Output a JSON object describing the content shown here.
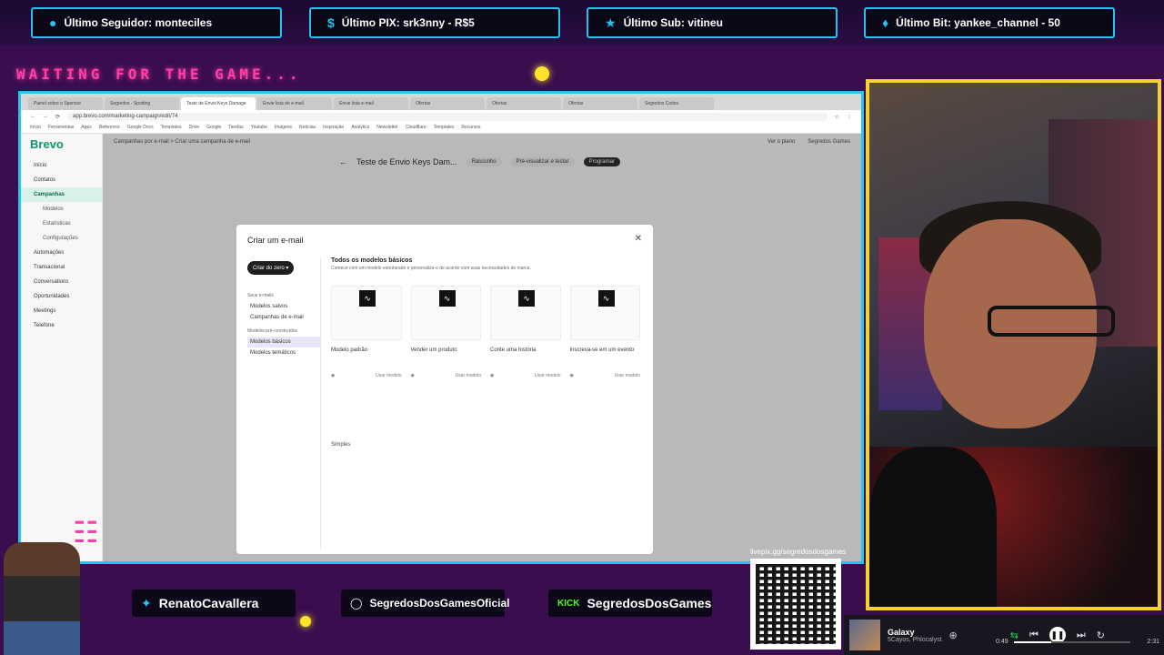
{
  "alerts": [
    {
      "icon": "person-icon",
      "label": "Último Seguidor: monteciles"
    },
    {
      "icon": "dollar-icon",
      "label": "Último PIX: srk3nny - R$5"
    },
    {
      "icon": "star-icon",
      "label": "Último Sub: vitineu"
    },
    {
      "icon": "gem-icon",
      "label": "Último Bit: yankee_channel - 50"
    }
  ],
  "waiting_text": "WAITING FOR THE GAME...",
  "browser": {
    "tabs": [
      "Painel sobre o Sponsor",
      "Segredos - Spotting",
      "Teste de Envio Keys Damage",
      "Envie lista de e-mail",
      "Envie lista e-mail",
      "Ofertas",
      "Ofertas",
      "Ofertas",
      "Segredos Codes"
    ],
    "url": "app.brevo.com/marketing-campaign/edit/74",
    "bookmarks": [
      "Início",
      "Ferramentas",
      "Apps",
      "Reference",
      "Google Docs",
      "Templates",
      "Drive",
      "Google",
      "Tarefas",
      "Youtube",
      "Imagens",
      "Notícias",
      "Inspiração",
      "Analytics",
      "Newsletter",
      "Cloudflare",
      "Templates",
      "Recursos"
    ]
  },
  "app": {
    "brand": "Brevo",
    "breadcrumb": "Campanhas por e-mail  >  Criar uma campanha de e-mail",
    "header_right": [
      "Ver o plano",
      "Segredos Games"
    ],
    "nav": [
      "Início",
      "Contatos",
      "Campanhas",
      "Modelos",
      "Estatísticas",
      "Configurações",
      "Automações",
      "Transacional",
      "Conversations",
      "Oportunidades",
      "Meetings",
      "Telefone"
    ],
    "campaign_name": "Teste de Envio Keys Dam...",
    "status": "Rascunho",
    "preview_label": "Pré-visualizar e testar",
    "schedule_label": "Programar"
  },
  "modal": {
    "title": "Criar um e-mail",
    "create_label": "Criar do zero",
    "your_emails_label": "Seus e-mails",
    "saved_templates": "Modelos salvos",
    "campaigns_email": "Campanhas de e-mail",
    "prebuilt_label": "Modelos pré-construídos",
    "basic_templates": "Modelos básicos",
    "themed_templates": "Modelos temáticos",
    "section_title": "Todos os modelos básicos",
    "section_desc": "Comece com um modelo estruturado e personalize-o de acordo com suas necessidades de marca.",
    "cards": [
      {
        "name": "Modelo padrão",
        "use": "Usar modelo"
      },
      {
        "name": "Vender um produto",
        "use": "Usar modelo"
      },
      {
        "name": "Conte uma história",
        "use": "Usar modelo"
      },
      {
        "name": "Inscreva-se em um evento",
        "use": "Usar modelo"
      }
    ],
    "simple_title": "Simples"
  },
  "socials": [
    {
      "icon": "twitter-icon",
      "label": "RenatoCavallera"
    },
    {
      "icon": "instagram-icon",
      "label": "SegredosDosGamesOficial"
    },
    {
      "icon": "kick-icon",
      "label": "SegredosDosGames"
    }
  ],
  "qr_label": "livepix.gg/segredosdosgames",
  "music": {
    "track": "Galaxy",
    "artist": "5Cayos, Phlocalyst",
    "elapsed": "0:49",
    "total": "2:31",
    "progress": 0.32
  },
  "colors": {
    "accent": "#27c3ee",
    "pink": "#ff3fa6",
    "yellow": "#f6d32a",
    "brevo_green": "#0b996e"
  }
}
